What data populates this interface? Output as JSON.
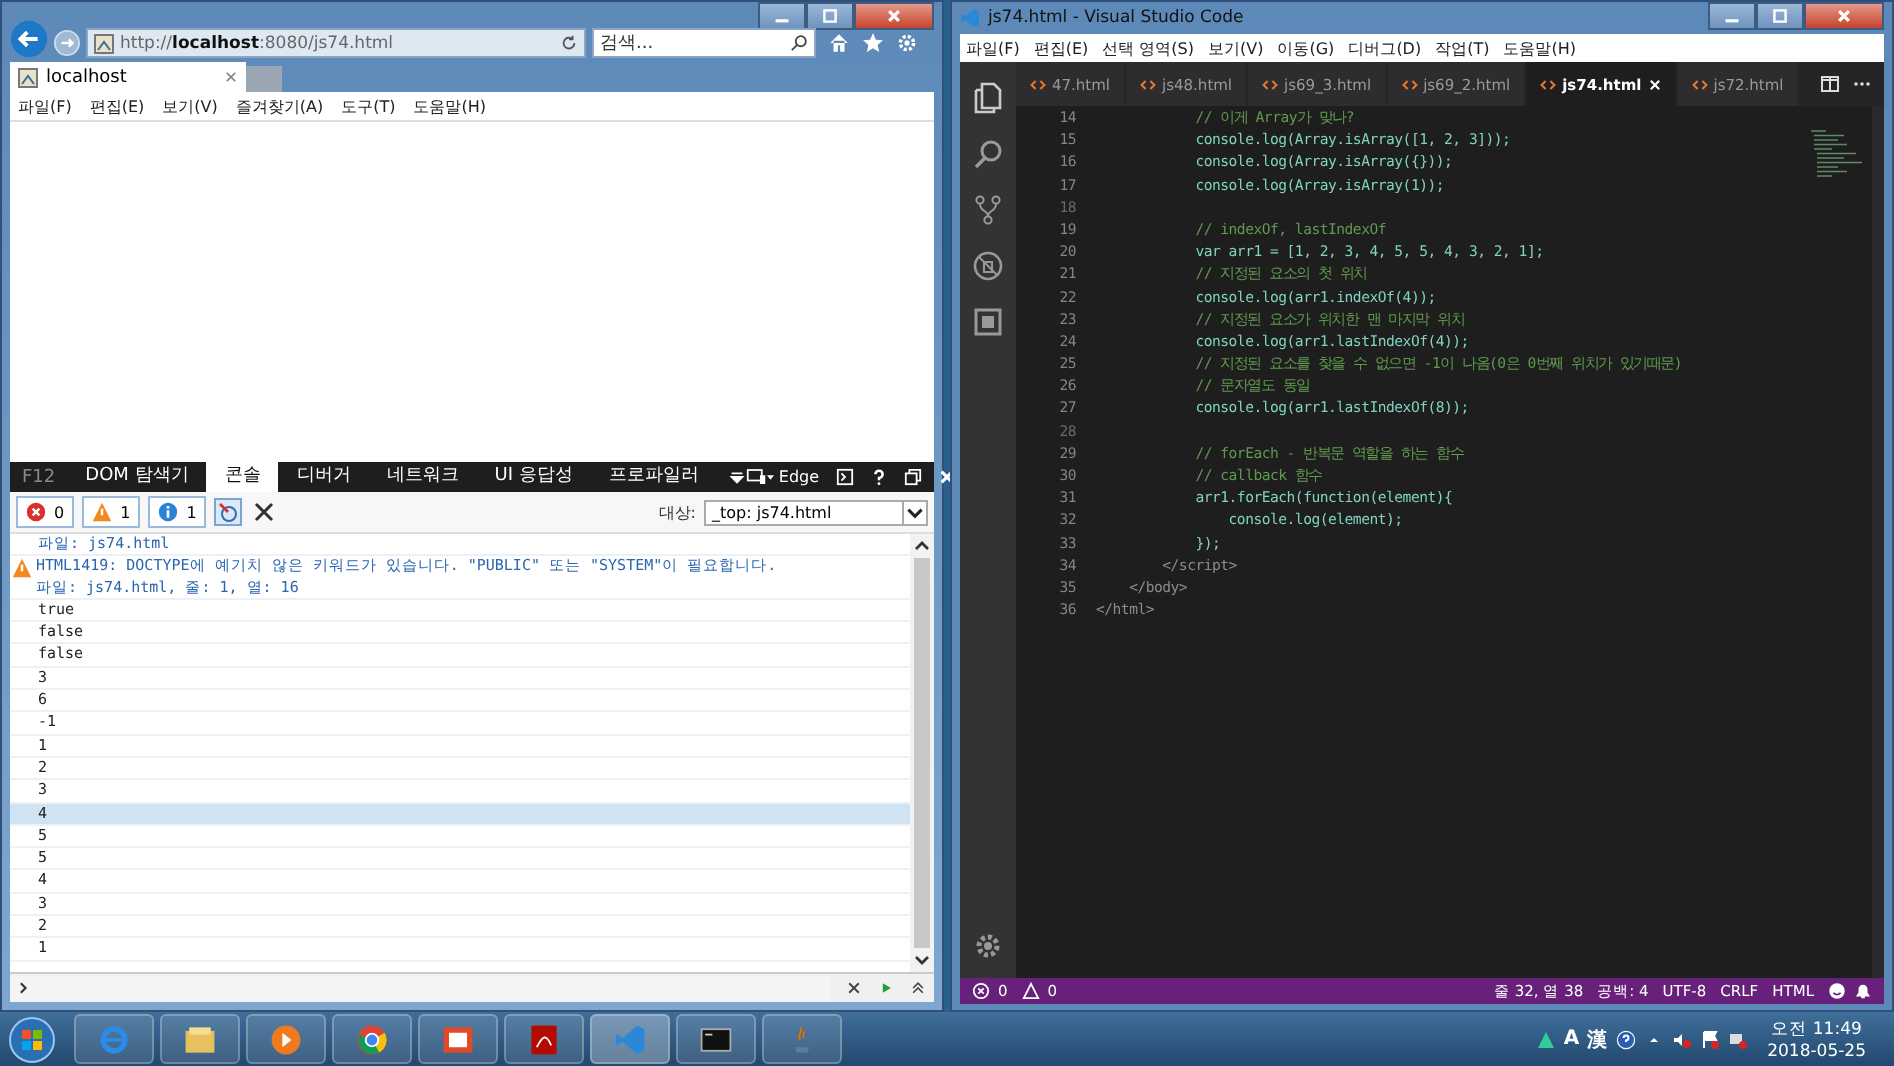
{
  "ie": {
    "address": "http://**localhost**:8080/js74.html",
    "search": {
      "placeholder": "검색..."
    },
    "tabs": [
      {
        "label": "localhost",
        "selected": true
      }
    ],
    "menu": [
      "파일(F)",
      "편집(E)",
      "보기(V)",
      "즐겨찾기(A)",
      "도구(T)",
      "도움말(H)"
    ]
  },
  "devtools": {
    "f12_label": "F12",
    "tabs": [
      {
        "label": "DOM 탐색기",
        "selected": false
      },
      {
        "label": "콘솔",
        "selected": true
      },
      {
        "label": "디버거",
        "selected": false
      },
      {
        "label": "네트워크",
        "selected": false
      },
      {
        "label": "UI 응답성",
        "selected": false
      },
      {
        "label": "프로파일러",
        "selected": false
      }
    ],
    "emulation": "Edge",
    "counters": [
      {
        "kind": "error",
        "count": "0"
      },
      {
        "kind": "warning",
        "count": "1"
      },
      {
        "kind": "info",
        "count": "1"
      }
    ],
    "target_label": "대상:",
    "target": "_top: js74.html",
    "messages": [
      {
        "kind": "source",
        "text": "파일: js74.html"
      },
      {
        "kind": "warning",
        "text": "HTML1419: DOCTYPE에 예기치 않은 키워드가 있습니다. \"PUBLIC\" 또는 \"SYSTEM\"이 필요합니다.",
        "source": "파일: js74.html, 줄: 1, 열: 16"
      }
    ],
    "outputs": [
      {
        "text": "true",
        "selected": false
      },
      {
        "text": "false",
        "selected": false
      },
      {
        "text": "false",
        "selected": false
      },
      {
        "text": "3",
        "selected": false
      },
      {
        "text": "6",
        "selected": false
      },
      {
        "text": "-1",
        "selected": false
      },
      {
        "text": "1",
        "selected": false
      },
      {
        "text": "2",
        "selected": false
      },
      {
        "text": "3",
        "selected": false
      },
      {
        "text": "4",
        "selected": true
      },
      {
        "text": "5",
        "selected": false
      },
      {
        "text": "5",
        "selected": false
      },
      {
        "text": "4",
        "selected": false
      },
      {
        "text": "3",
        "selected": false
      },
      {
        "text": "2",
        "selected": false
      },
      {
        "text": "1",
        "selected": false
      }
    ]
  },
  "vscode": {
    "title": "js74.html - Visual Studio Code",
    "menu": [
      "파일(F)",
      "편집(E)",
      "선택 영역(S)",
      "보기(V)",
      "이동(G)",
      "디버그(D)",
      "작업(T)",
      "도움말(H)"
    ],
    "tabs": [
      {
        "label": "47.html",
        "selected": false
      },
      {
        "label": "js48.html",
        "selected": false
      },
      {
        "label": "js69_3.html",
        "selected": false
      },
      {
        "label": "js69_2.html",
        "selected": false
      },
      {
        "label": "js74.html",
        "selected": true
      },
      {
        "label": "js72.html",
        "selected": false
      }
    ],
    "lines": [
      {
        "number": "14",
        "kind": "comment",
        "text": "            // 이게 Array가 맞나?"
      },
      {
        "number": "15",
        "kind": "code",
        "text": "            console.log(Array.isArray([1, 2, 3]));"
      },
      {
        "number": "16",
        "kind": "code",
        "text": "            console.log(Array.isArray({}));"
      },
      {
        "number": "17",
        "kind": "code",
        "text": "            console.log(Array.isArray(1));"
      },
      {
        "number": "18",
        "kind": "blank"
      },
      {
        "number": "19",
        "kind": "comment",
        "text": "            // indexOf, lastIndexOf"
      },
      {
        "number": "20",
        "kind": "code",
        "text": "            var arr1 = [1, 2, 3, 4, 5, 5, 4, 3, 2, 1];"
      },
      {
        "number": "21",
        "kind": "comment",
        "text": "            // 지정된 요소의 첫 위치"
      },
      {
        "number": "22",
        "kind": "code",
        "text": "            console.log(arr1.indexOf(4));"
      },
      {
        "number": "23",
        "kind": "comment",
        "text": "            // 지정된 요소가 위치한 맨 마지막 위치"
      },
      {
        "number": "24",
        "kind": "code",
        "text": "            console.log(arr1.lastIndexOf(4));"
      },
      {
        "number": "25",
        "kind": "comment",
        "text": "            // 지정된 요소를 찾을 수 없으면 -1이 나옴(0은 0번째 위치가 있기때문)"
      },
      {
        "number": "26",
        "kind": "comment",
        "text": "            // 문자열도 동일"
      },
      {
        "number": "27",
        "kind": "code",
        "text": "            console.log(arr1.lastIndexOf(8));"
      },
      {
        "number": "28",
        "kind": "blank"
      },
      {
        "number": "29",
        "kind": "comment",
        "text": "            // forEach - 반복문 역할을 하는 함수"
      },
      {
        "number": "30",
        "kind": "comment",
        "text": "            // callback 함수"
      },
      {
        "number": "31",
        "kind": "code",
        "text": "            arr1.forEach(function(element){"
      },
      {
        "number": "32",
        "kind": "code",
        "text": "                console.log(element);"
      },
      {
        "number": "33",
        "kind": "code",
        "text": "            });"
      },
      {
        "number": "34",
        "kind": "tag",
        "text": "        </script>"
      },
      {
        "number": "35",
        "kind": "tag",
        "text": "    </body>"
      },
      {
        "number": "36",
        "kind": "tag",
        "text": "</html>"
      }
    ],
    "problems": [
      {
        "kind": "error",
        "count": "0"
      },
      {
        "kind": "warning",
        "count": "0"
      }
    ],
    "status_items": [
      "줄 32, 열 38",
      "공백: 4",
      "UTF-8",
      "CRLF",
      "HTML"
    ]
  },
  "taskbar": {
    "ime": [
      "A",
      "漢"
    ],
    "time": "오전 11:49",
    "date": "2018-05-25"
  }
}
